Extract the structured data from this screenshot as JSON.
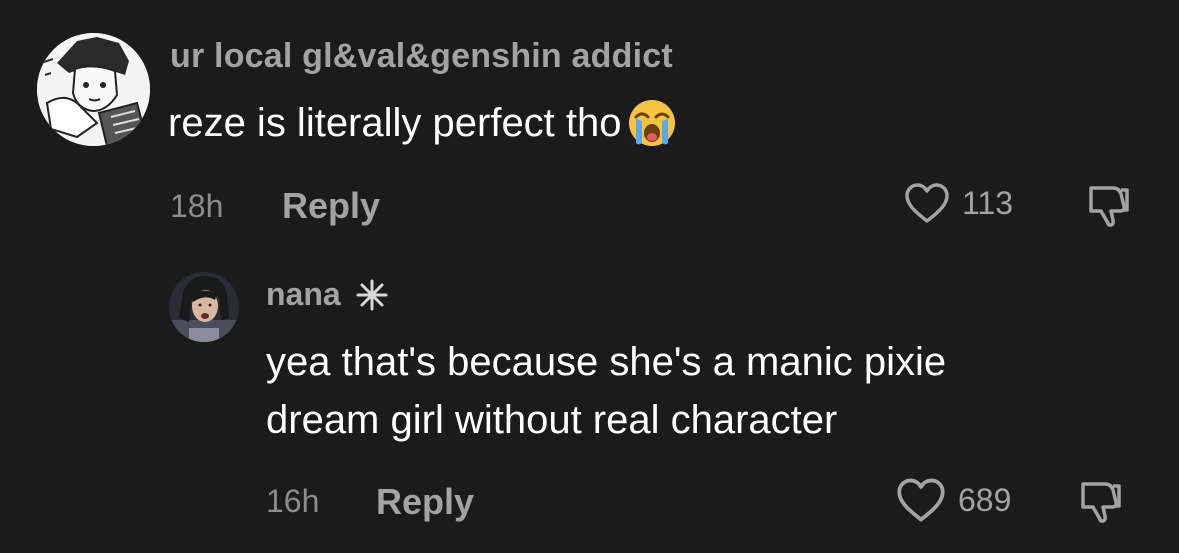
{
  "comments": [
    {
      "username": "ur local gl&val&genshin addict",
      "text": "reze is literally perfect tho",
      "emoji": "loudly-crying-face-emoji",
      "time": "18h",
      "reply_label": "Reply",
      "likes": "113",
      "avatar": "manga-character-avatar"
    },
    {
      "username": "nana",
      "badge_icon": "sparkle-icon",
      "text_lines": [
        "yea that's because she's a manic pixie",
        "dream girl without real character"
      ],
      "time": "16h",
      "reply_label": "Reply",
      "likes": "689",
      "avatar": "photo-avatar"
    }
  ],
  "colors": {
    "background": "#1b1b1b",
    "text_primary": "#ffffff",
    "text_secondary": "#a3a3a3",
    "text_time": "#8c8c8c"
  }
}
